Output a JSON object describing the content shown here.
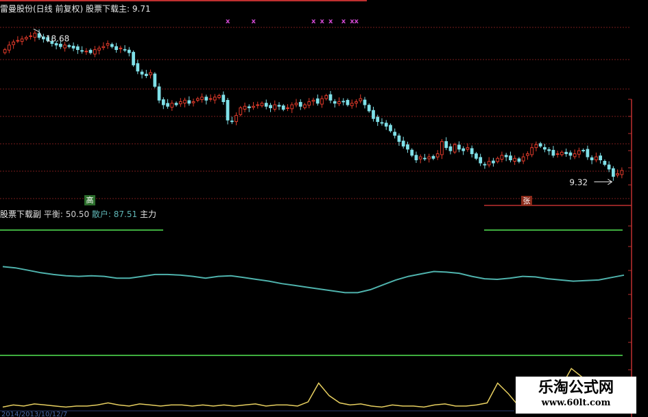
{
  "main_panel": {
    "title_prefix": "雷曼股份(日线 前复权)",
    "title_indicator": "股票下载主",
    "title_value": ": 9.71",
    "high_label": "18.68",
    "low_label": "9.32"
  },
  "sub_panel": {
    "name": "股票下载副",
    "k2": "平衡:",
    "v2": "50.50",
    "k3": "散户:",
    "v3": "87.51",
    "k4": "主力"
  },
  "badges": {
    "gao": "高",
    "zhang": "张"
  },
  "watermark": {
    "cn": "乐淘公式网",
    "en": "www.60lt.com"
  },
  "date_bar": "2014/2013/10/12/7",
  "colors": {
    "up": "#e03a2a",
    "down": "#7fe0e8",
    "grid": "#7a1c1c",
    "retail_line": "#4fb3ad",
    "main_force_line": "#e8d060",
    "green_line": "#3fae3f",
    "axis_red": "#c03030",
    "marker": "#d048d0"
  },
  "chart_data": [
    {
      "type": "candlestick",
      "title": "雷曼股份(日线 前复权) 股票下载主: 9.71",
      "ylim": [
        8.5,
        19.5
      ],
      "grid": true,
      "annotations": [
        {
          "label": "18.68",
          "index": 7,
          "value": 18.68
        },
        {
          "label": "9.32",
          "index": 142,
          "value": 9.32
        }
      ],
      "markers_x_indices": [
        52,
        58,
        72,
        74,
        76,
        79,
        81,
        82
      ],
      "markers_label": "x",
      "close": [
        17.6,
        17.9,
        18.1,
        18.2,
        18.3,
        18.4,
        18.5,
        18.68,
        18.4,
        18.3,
        18.2,
        18.0,
        17.9,
        17.8,
        17.9,
        17.8,
        17.7,
        17.6,
        17.5,
        17.5,
        17.4,
        17.6,
        17.7,
        17.8,
        18.0,
        17.8,
        17.6,
        17.7,
        17.6,
        17.4,
        16.6,
        16.2,
        16.0,
        15.9,
        16.1,
        15.2,
        14.3,
        14.0,
        13.9,
        14.1,
        14.0,
        14.2,
        14.3,
        14.1,
        14.2,
        14.4,
        14.5,
        14.3,
        14.4,
        14.5,
        14.6,
        14.2,
        13.0,
        12.9,
        13.3,
        13.8,
        13.9,
        13.8,
        13.9,
        14.0,
        14.1,
        13.9,
        13.8,
        14.0,
        13.9,
        13.7,
        13.8,
        14.0,
        14.1,
        13.9,
        14.0,
        14.2,
        14.3,
        14.1,
        14.4,
        14.6,
        14.3,
        14.1,
        14.2,
        14.2,
        14.0,
        14.1,
        14.2,
        14.4,
        14.0,
        13.6,
        13.1,
        12.9,
        12.8,
        12.6,
        12.3,
        12.0,
        11.6,
        11.3,
        11.1,
        10.7,
        10.4,
        10.6,
        10.5,
        10.6,
        10.5,
        10.8,
        11.6,
        11.2,
        11.0,
        11.4,
        11.1,
        11.0,
        11.2,
        10.8,
        10.5,
        10.2,
        10.1,
        10.3,
        10.2,
        10.5,
        10.7,
        10.6,
        10.4,
        10.5,
        10.3,
        10.6,
        10.8,
        11.2,
        11.4,
        11.3,
        11.1,
        11.0,
        10.7,
        10.8,
        10.9,
        10.8,
        10.7,
        10.8,
        11.0,
        11.0,
        10.6,
        10.4,
        10.6,
        10.4,
        10.1,
        9.8,
        9.32,
        9.5,
        9.71
      ]
    },
    {
      "type": "line",
      "series": [
        {
          "name": "散户",
          "values": [
            98,
            96,
            92,
            88,
            85,
            83,
            82,
            83,
            82,
            79,
            79,
            82,
            85,
            85,
            84,
            82,
            79,
            82,
            83,
            80,
            77,
            74,
            70,
            67,
            64,
            61,
            58,
            55,
            55,
            60,
            68,
            76,
            82,
            86,
            90,
            89,
            87,
            82,
            78,
            77,
            79,
            82,
            81,
            78,
            76,
            74,
            75,
            76,
            80,
            84
          ]
        }
      ],
      "ylim": [
        0,
        120
      ]
    },
    {
      "type": "line",
      "series": [
        {
          "name": "主力",
          "values": [
            1,
            3,
            2,
            4,
            3,
            2,
            1,
            2,
            2,
            3,
            5,
            3,
            2,
            4,
            3,
            2,
            3,
            3,
            2,
            3,
            2,
            3,
            2,
            3,
            4,
            2,
            3,
            3,
            2,
            6,
            24,
            12,
            5,
            3,
            4,
            2,
            1,
            3,
            2,
            2,
            1,
            3,
            4,
            2,
            2,
            3,
            5,
            24,
            14,
            2,
            1,
            2,
            9,
            20,
            38,
            30,
            16,
            12,
            14,
            20
          ]
        }
      ],
      "ylim": [
        0,
        50
      ]
    }
  ]
}
